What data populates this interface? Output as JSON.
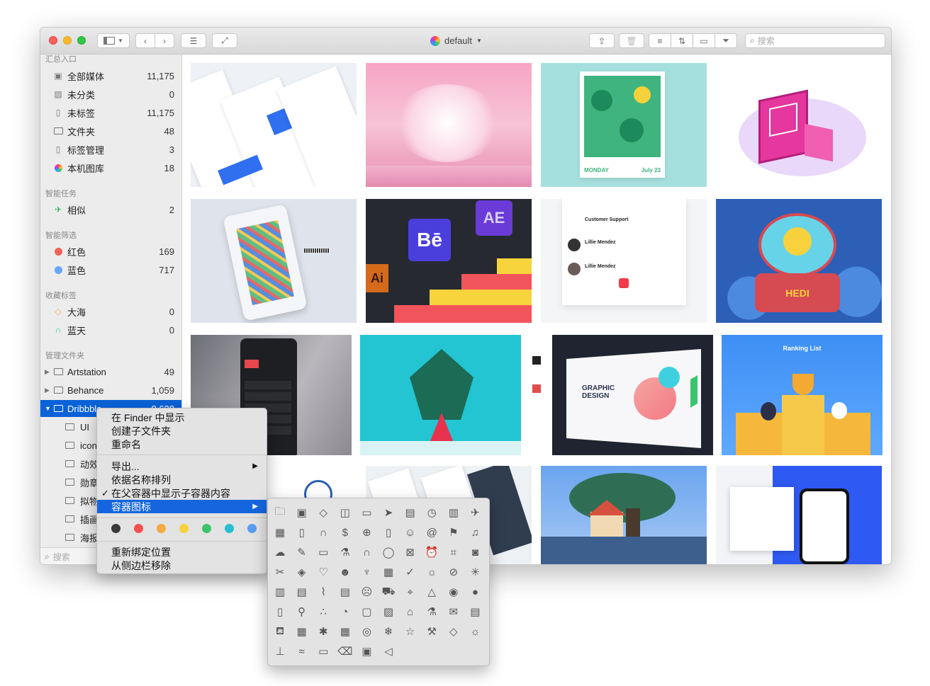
{
  "window": {
    "title": "default"
  },
  "toolbar": {
    "search_placeholder": "搜索"
  },
  "sidebar": {
    "sections": {
      "entry": "汇总入口",
      "smart_tasks": "智能任务",
      "smart_filters": "智能筛选",
      "fav_tags": "收藏标签",
      "managed_folders": "管理文件夹"
    },
    "entry_items": [
      {
        "label": "全部媒体",
        "count": "11,175"
      },
      {
        "label": "未分类",
        "count": "0"
      },
      {
        "label": "未标签",
        "count": "11,175"
      },
      {
        "label": "文件夹",
        "count": "48"
      },
      {
        "label": "标签管理",
        "count": "3"
      },
      {
        "label": "本机图库",
        "count": "18"
      }
    ],
    "task_items": [
      {
        "label": "相似",
        "count": "2"
      }
    ],
    "filter_items": [
      {
        "label": "红色",
        "count": "169",
        "color": "#f0625a"
      },
      {
        "label": "蓝色",
        "count": "717",
        "color": "#6aa6f8"
      }
    ],
    "tag_items": [
      {
        "label": "大海",
        "count": "0",
        "color": "#f5b14a"
      },
      {
        "label": "蓝天",
        "count": "0",
        "color": "#2fc6a6"
      }
    ],
    "folder_items": [
      {
        "label": "Artstation",
        "count": "49"
      },
      {
        "label": "Behance",
        "count": "1,059"
      },
      {
        "label": "Dribbble",
        "count": "8,638"
      }
    ],
    "subfolders": [
      "UI",
      "icon",
      "动效",
      "勋章",
      "拟物",
      "插画",
      "海报"
    ],
    "search_placeholder": "搜索"
  },
  "context_menu": {
    "items": [
      "在 Finder 中显示",
      "创建子文件夹",
      "重命名"
    ],
    "items2": [
      "导出...",
      "依据名称排列",
      "在父容器中显示子容器内容",
      "容器图标"
    ],
    "colors": [
      "#3a3a3a",
      "#f0514e",
      "#f5a941",
      "#f7d33c",
      "#3cc46a",
      "#26bfd2",
      "#5a9cf6"
    ],
    "items3": [
      "重新绑定位置",
      "从侧边栏移除"
    ]
  },
  "icon_grid": [
    [
      "folder-icon",
      "archive-box-icon",
      "tag-icon",
      "shopping-bag-icon",
      "monitor-icon",
      "send-icon",
      "clipboard-icon",
      "clock-icon",
      "bar-chart-icon",
      "airplane-icon"
    ],
    [
      "map-icon",
      "phone-icon",
      "headphones-icon",
      "dollar-icon",
      "basketball-icon",
      "document-icon",
      "smile-icon",
      "at-sign-icon",
      "flag-icon",
      "music-note-icon"
    ],
    [
      "cloud-icon",
      "edit-icon",
      "keyboard-icon",
      "flask-icon",
      "headset-icon",
      "chat-icon",
      "close-box-icon",
      "alarm-icon",
      "crop-icon",
      "instagram-icon"
    ],
    [
      "tools-icon",
      "label-icon",
      "heart-icon",
      "users-icon",
      "trophy-icon",
      "calendar-icon",
      "check-circle-icon",
      "lightbulb-icon",
      "compass-icon",
      "sparkle-icon"
    ],
    [
      "stats-icon",
      "calculator-icon",
      "paperclip-icon",
      "inbox-icon",
      "sad-face-icon",
      "truck-icon",
      "robot-icon",
      "bell-icon",
      "broadcast-icon",
      "record-icon"
    ],
    [
      "smartphone-icon",
      "bicycle-icon",
      "nodes-icon",
      "palette-icon",
      "lock-icon",
      "image-icon",
      "home-icon",
      "beaker-icon",
      "mail-icon",
      "database-icon"
    ],
    [
      "watering-can-icon",
      "film-icon",
      "bug-icon",
      "calendar-grid-icon",
      "aperture-icon",
      "snowflake-icon",
      "star-icon",
      "wrench-icon",
      "tags-icon",
      "sun-icon"
    ],
    [
      "thermometer-icon",
      "wave-icon",
      "tv-icon",
      "trash-icon",
      "portrait-icon",
      "speaker-icon"
    ]
  ],
  "gallery": {
    "texts": {
      "ae": "AE",
      "be": "Bē",
      "ai": "Ai",
      "monday": "MONDAY",
      "july": "July 23",
      "graphic": "GRAPHIC DESIGN",
      "ranking": "Ranking List",
      "cs": "Customer Support",
      "lm": "Lillie Mendez",
      "hedi": "HEDI"
    }
  }
}
